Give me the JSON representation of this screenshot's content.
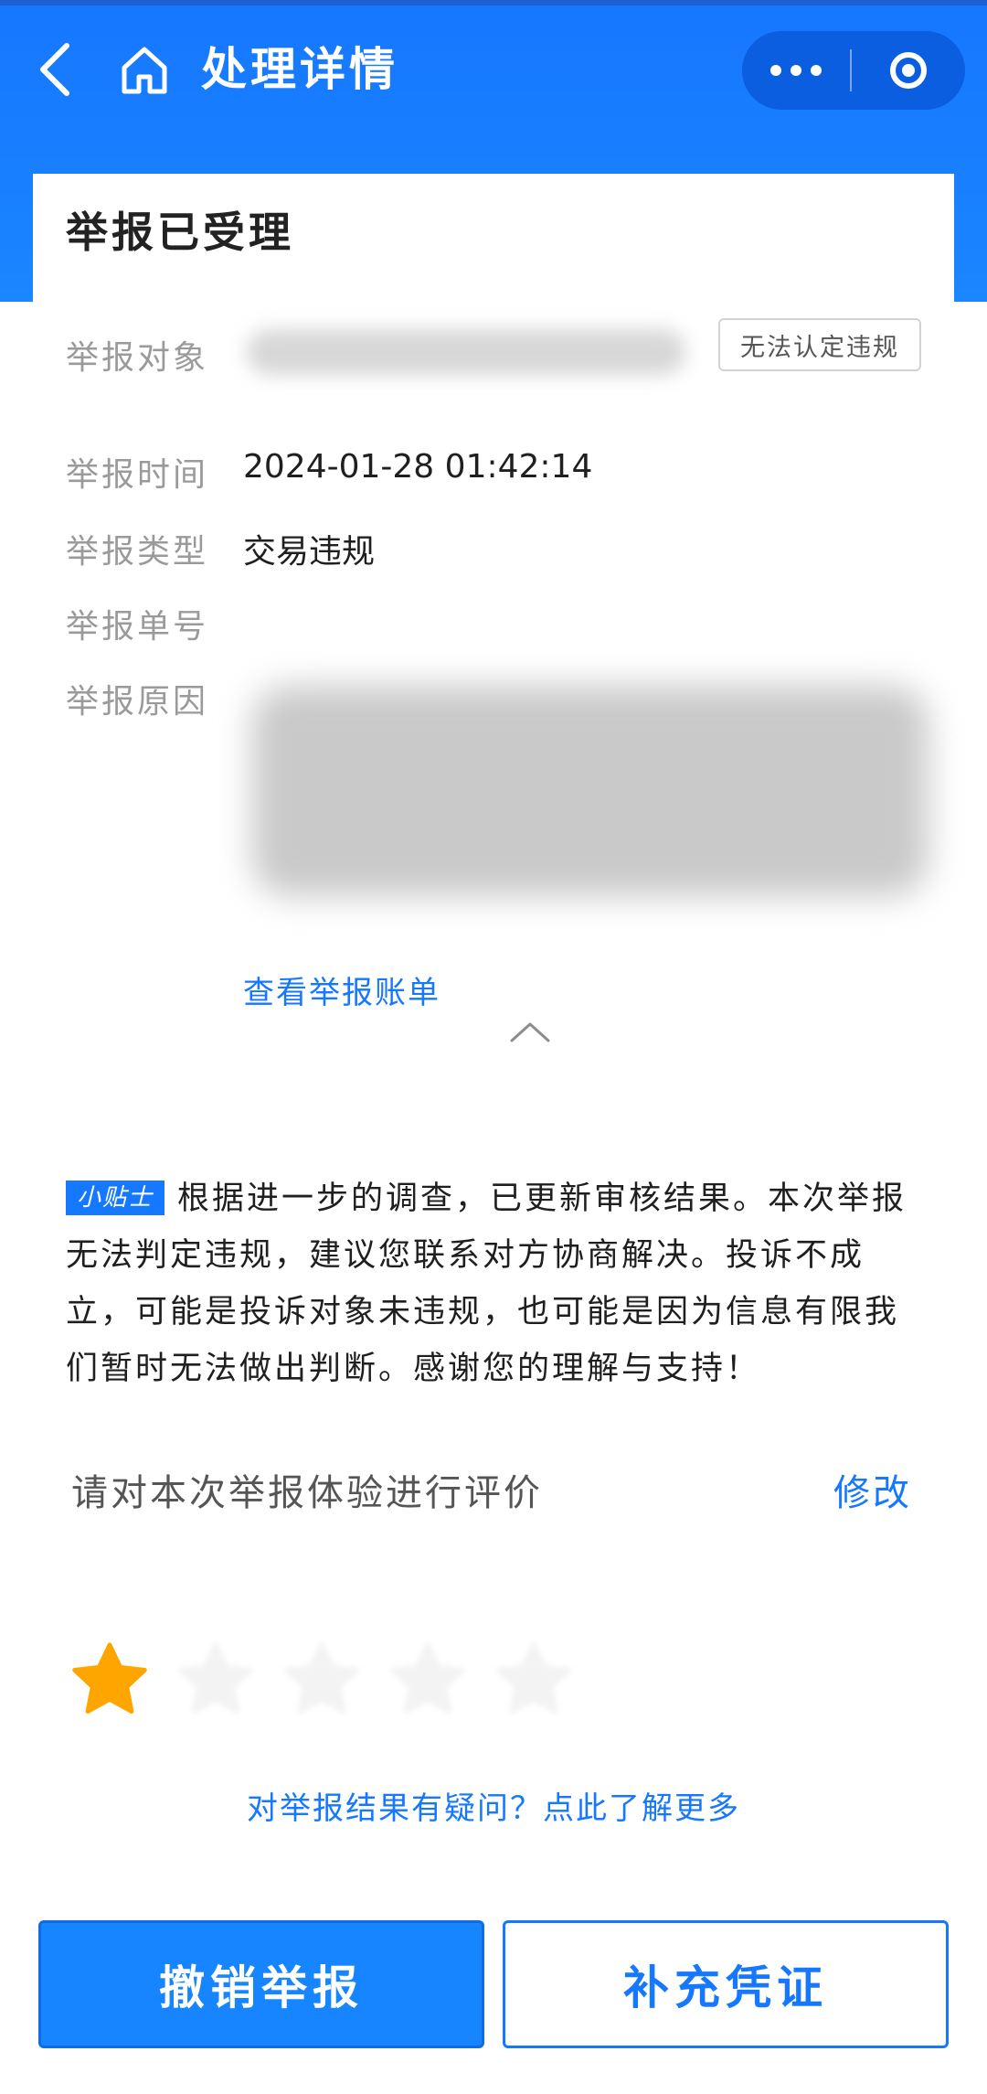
{
  "header": {
    "title": "处理详情",
    "icons": {
      "back": "chevron-left-icon",
      "home": "home-icon",
      "more": "more-dots-icon",
      "close": "target-circle-icon"
    }
  },
  "status": {
    "title": "举报已受理"
  },
  "details": {
    "target_label": "举报对象",
    "target_verdict": "无法认定违规",
    "time_label": "举报时间",
    "time_value": "2024-01-28 01:42:14",
    "type_label": "举报类型",
    "type_value": "交易违规",
    "number_label": "举报单号",
    "reason_label": "举报原因"
  },
  "links": {
    "view_bill": "查看举报账单",
    "learn_more": "对举报结果有疑问？点此了解更多"
  },
  "tip": {
    "badge": "小贴士",
    "text": "根据进一步的调查，已更新审核结果。本次举报无法判定违规，建议您联系对方协商解决。投诉不成立，可能是投诉对象未违规，也可能是因为信息有限我们暂时无法做出判断。感谢您的理解与支持！"
  },
  "rating": {
    "prompt": "请对本次举报体验进行评价",
    "edit_label": "修改",
    "value": 1,
    "max": 5,
    "star_color": "#ffa500"
  },
  "actions": {
    "cancel": "撤销举报",
    "supplement": "补充凭证"
  },
  "colors": {
    "primary": "#1677ff",
    "header": "#1677ff"
  }
}
